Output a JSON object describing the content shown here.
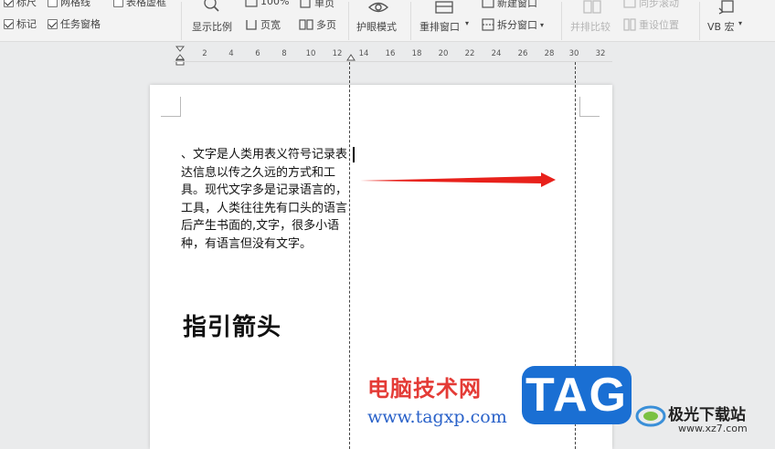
{
  "toolbar": {
    "checkboxes": [
      {
        "label": "标尺",
        "checked": true
      },
      {
        "label": "网格线",
        "checked": false
      },
      {
        "label": "表格虚框",
        "checked": false
      },
      {
        "label": "标记",
        "checked": true
      },
      {
        "label": "任务窗格",
        "checked": true
      }
    ],
    "show_ratio": "显示比例",
    "zoom_100": "100%",
    "single_page": "单页",
    "page_width": "页宽",
    "multi_page": "多页",
    "eye_mode": "护眼模式",
    "arrange_window": "重排窗口",
    "new_window": "新建窗口",
    "split_window": "拆分窗口",
    "side_by_side": "并排比较",
    "sync_scroll": "同步滚动",
    "reset_position": "重设位置",
    "vb_macro": "VB 宏"
  },
  "ruler": {
    "ticks": [
      "2",
      "4",
      "6",
      "8",
      "10",
      "12",
      "14",
      "16",
      "18",
      "20",
      "22",
      "24",
      "26",
      "28",
      "30",
      "32"
    ]
  },
  "document": {
    "body_text": "、文字是人类用表义符号记录表达信息以传之久远的方式和工具。现代文字多是记录语言的，工具，人类往往先有口头的语言后产生书面的,文字，很多小语种，有语言但没有文字。",
    "heading": "指引箭头"
  },
  "arrow": {
    "color": "#e8211b",
    "shape": "pointer-arrow"
  },
  "watermark": {
    "site_title": "电脑技术网",
    "site_url": "www.tagxp.com",
    "badge": "TAG",
    "xz_name": "极光下载站",
    "xz_url": "www.xz7.com"
  },
  "colors": {
    "watermark_red": "#e43b36",
    "watermark_blue": "#2a62c9",
    "badge_blue": "#1a6fd3"
  }
}
